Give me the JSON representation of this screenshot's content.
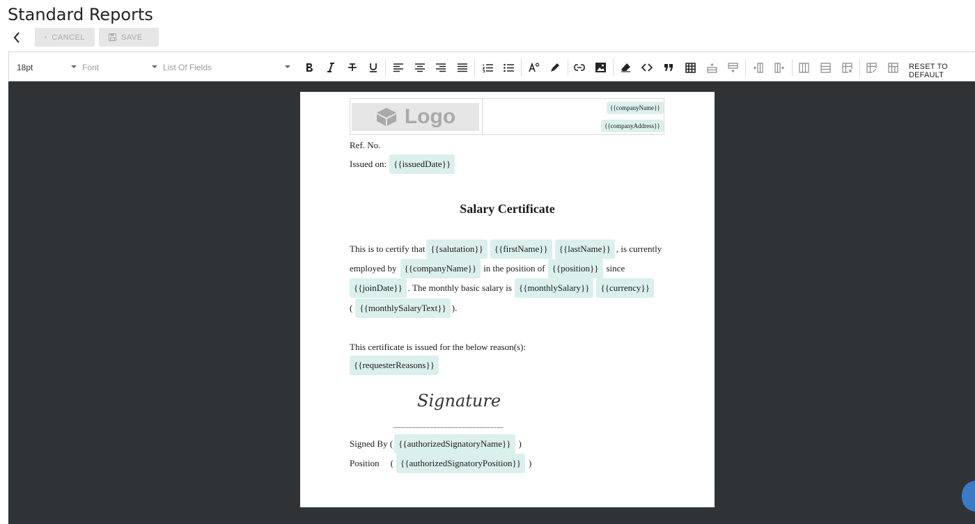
{
  "header": {
    "title": "Standard Reports"
  },
  "actions": {
    "cancel_label": "CANCEL",
    "save_label": "SAVE"
  },
  "toolbar": {
    "font_size": "18pt",
    "font_placeholder": "Font",
    "fields_placeholder": "List Of Fields",
    "reset_label": "RESET TO DEFAULT"
  },
  "document": {
    "header": {
      "logo_text": "Logo",
      "company_name": "{{companyName}}",
      "company_address": "{{companyAddress}}"
    },
    "ref_no": "Ref. No.",
    "issued_on_label": "Issued on:",
    "issued_date": "{{issuedDate}}",
    "title": "Salary Certificate",
    "body": {
      "line1_prefix": "This is to certify that",
      "salutation": "{{salutation}}",
      "first_name": "{{firstName}}",
      "last_name": "{{lastName}}",
      "line1_suffix": ", is currently",
      "line2_prefix": "employed by",
      "company_name": "{{companyName}}",
      "line2_mid": "in the position of",
      "position": "{{position}}",
      "line2_suffix": "since",
      "join_date": "{{joinDate}}",
      "line3_mid": ". The monthly basic salary is",
      "monthly_salary": "{{monthlySalary}}",
      "currency": "{{currency}}",
      "paren_open": "(",
      "monthly_salary_text": "{{monthlySalaryText}}",
      "paren_close": ")."
    },
    "reason_label": "This certificate is issued for the below reason(s):",
    "requester_reasons": "{{requesterReasons}}",
    "signature_text": "Signature",
    "signed_by_label": "Signed By (",
    "authorized_signatory_name": "{{authorizedSignatoryName}}",
    "position_label": "Position",
    "paren_open": "(",
    "authorized_signatory_position": "{{authorizedSignatoryPosition}}",
    "paren_close": ")"
  },
  "icons": {
    "back": "chevron-left-icon",
    "cancel": "close-icon",
    "save": "floppy-disk-icon"
  },
  "colors": {
    "chip_bg": "#dbf0ec",
    "canvas_bg": "#2f3336",
    "help_button": "#3a7ac7"
  }
}
